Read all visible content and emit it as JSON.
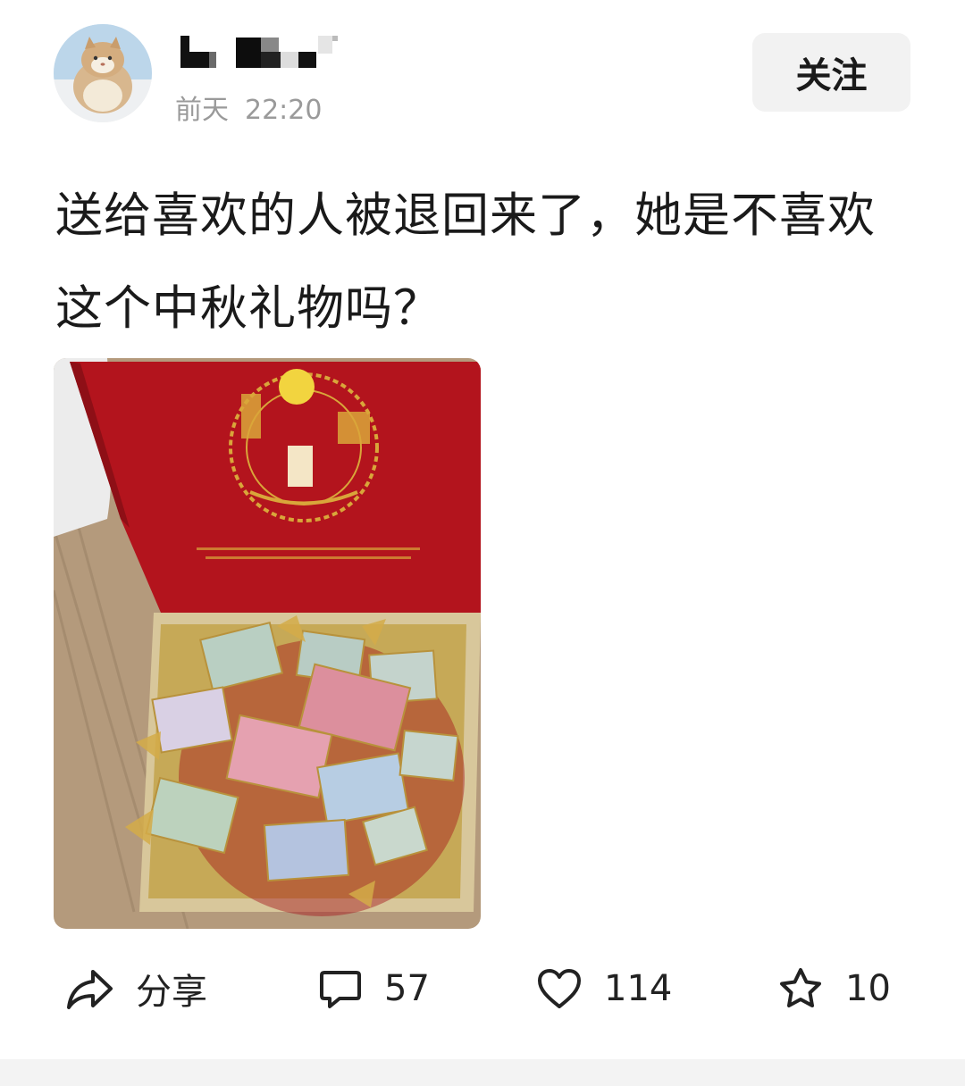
{
  "post": {
    "time_day": "前天",
    "time_clock": "22:20",
    "follow_label": "关注",
    "text": "送给喜欢的人被退回来了，她是不喜欢这个中秋礼物吗？"
  },
  "actions": {
    "share_label": "分享",
    "comments_count": "57",
    "likes_count": "114",
    "favorites_count": "10"
  },
  "icons": [
    "avatar-cat",
    "share-icon",
    "comment-icon",
    "heart-icon",
    "star-icon"
  ],
  "colors": {
    "box_red": "#b0151e",
    "accent_gold": "#c9a340",
    "muted_text": "#9a9a9a"
  }
}
